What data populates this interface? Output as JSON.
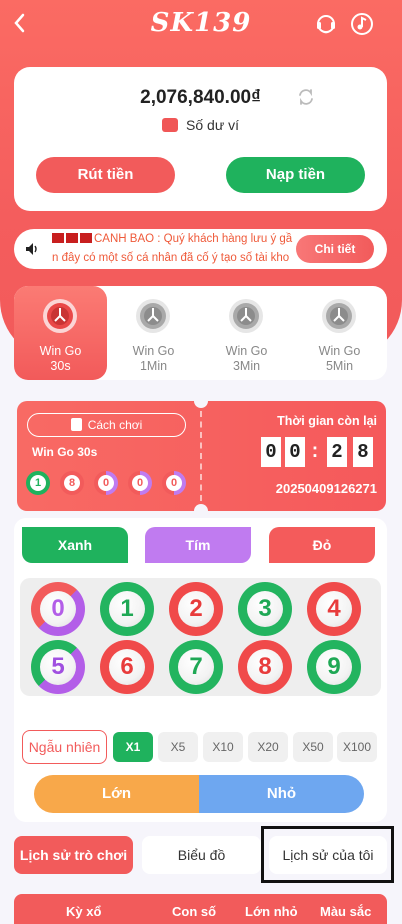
{
  "header": {
    "logo": "SK139",
    "back": "‹"
  },
  "wallet": {
    "balance": "2,076,840.00₫",
    "label": "Số dư ví",
    "withdraw": "Rút tiền",
    "deposit": "Nạp tiền"
  },
  "notice": {
    "line1": "CANH BAO : Quý khách hàng lưu ý gầ",
    "line2": "n đây có một số cá nhân đã cố ý tạo số tài kho",
    "detail": "Chi tiết"
  },
  "modes": [
    {
      "line1": "Win Go",
      "line2": "30s"
    },
    {
      "line1": "Win Go",
      "line2": "1Min"
    },
    {
      "line1": "Win Go",
      "line2": "3Min"
    },
    {
      "line1": "Win Go",
      "line2": "5Min"
    }
  ],
  "game": {
    "how_to": "Cách chơi",
    "name": "Win Go 30s",
    "recent": [
      "1",
      "8",
      "0",
      "0",
      "0"
    ],
    "time_label": "Thời gian còn lại",
    "timer": [
      "0",
      "0",
      ":",
      "2",
      "8"
    ],
    "period": "20250409126271"
  },
  "colors_bet": {
    "green": "Xanh",
    "violet": "Tím",
    "red": "Đỏ"
  },
  "numbers": [
    "0",
    "1",
    "2",
    "3",
    "4",
    "5",
    "6",
    "7",
    "8",
    "9"
  ],
  "random": "Ngẫu nhiên",
  "multipliers": [
    "X1",
    "X5",
    "X10",
    "X20",
    "X50",
    "X100"
  ],
  "big": "Lớn",
  "small": "Nhỏ",
  "tabs": {
    "game_history": "Lịch sử trò chơi",
    "chart": "Biểu đồ",
    "my_history": "Lịch sử của tôi"
  },
  "table_headers": {
    "period": "Kỳ xổ",
    "number": "Con số",
    "big_small": "Lớn nhỏ",
    "color": "Màu sắc"
  },
  "palette": {
    "red": "#f25b5b",
    "green": "#1fb25d",
    "violet": "#c07bf0",
    "orange": "#f8a84a",
    "blue": "#6ea7f0"
  }
}
